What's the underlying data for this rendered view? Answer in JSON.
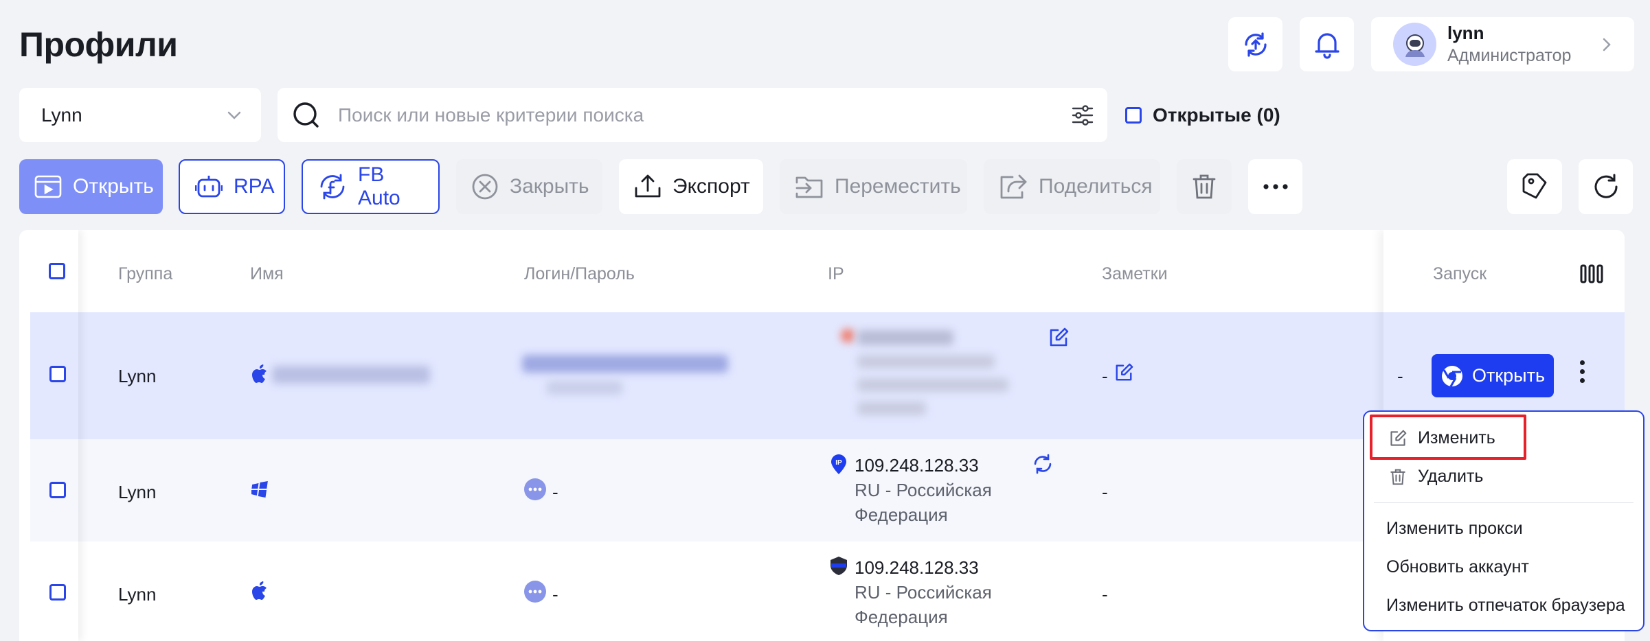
{
  "header": {
    "title": "Профили",
    "user": {
      "name": "lynn",
      "role": "Администратор"
    }
  },
  "filters": {
    "group_value": "Lynn",
    "search_placeholder": "Поиск или новые критерии поиска",
    "opened_label": "Открытые (0)"
  },
  "toolbar": {
    "open": "Открыть",
    "rpa": "RPA",
    "fb_auto": "FB Auto",
    "close": "Закрыть",
    "export": "Экспорт",
    "move": "Переместить",
    "share": "Поделиться"
  },
  "table": {
    "columns": {
      "group": "Группа",
      "name": "Имя",
      "login": "Логин/Пароль",
      "ip": "IP",
      "notes": "Заметки",
      "launch": "Запуск"
    },
    "rows": [
      {
        "group": "Lynn",
        "os": "apple-icon",
        "name": "",
        "login": "",
        "ip": "",
        "ip_sub": "",
        "notes": "-",
        "open_label": "Открыть"
      },
      {
        "group": "Lynn",
        "os": "windows-icon",
        "name": "",
        "login": "-",
        "ip": "109.248.128.33",
        "ip_sub": "RU - Российская Федерация",
        "notes": "-"
      },
      {
        "group": "Lynn",
        "os": "apple-icon",
        "name": "",
        "login": "-",
        "ip": "109.248.128.33",
        "ip_sub": "RU - Российская Федерация",
        "notes": "-"
      }
    ],
    "hidden_col_dash": "-"
  },
  "context_menu": {
    "edit": "Изменить",
    "delete": "Удалить",
    "change_proxy": "Изменить прокси",
    "update_account": "Обновить аккаунт",
    "change_fingerprint": "Изменить отпечаток браузера"
  },
  "colors": {
    "accent": "#2a45e8",
    "primary_btn": "#1f3df0",
    "selected_row": "#e3e8ff",
    "highlight": "#e8202a"
  }
}
